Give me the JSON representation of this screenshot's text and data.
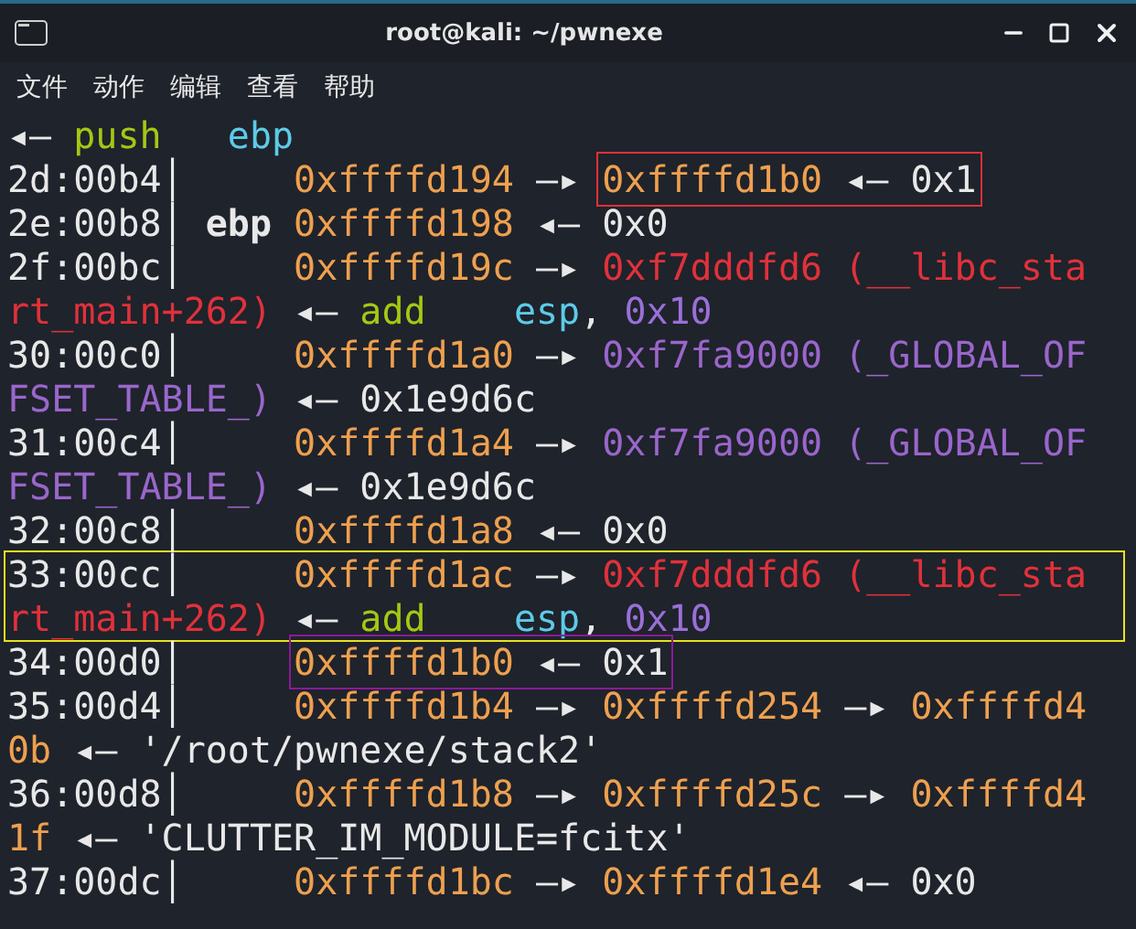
{
  "window": {
    "title": "root@kali: ~/pwnexe"
  },
  "menu": [
    {
      "label": "文件"
    },
    {
      "label": "动作"
    },
    {
      "label": "编辑"
    },
    {
      "label": "查看"
    },
    {
      "label": "帮助"
    }
  ],
  "terminal": {
    "records": [
      {
        "lines": [
          {
            "segments": [
              {
                "kind": "text",
                "text": "◂— ",
                "color": "#e8e8e8"
              },
              {
                "kind": "text",
                "text": "push   ",
                "color": "#a4c814"
              },
              {
                "kind": "text",
                "text": "ebp",
                "color": "#5ccbe8"
              }
            ]
          }
        ]
      },
      {
        "lines": [
          {
            "segments": [
              {
                "kind": "text",
                "text": "2d:00b4│     ",
                "color": "#e8e8e8"
              },
              {
                "kind": "text",
                "text": "0xffffd194",
                "color": "#eea04f"
              },
              {
                "kind": "text",
                "text": " —▸ ",
                "color": "#e8e8e8"
              },
              {
                "kind": "box",
                "color": "#e02f38",
                "segments": [
                  {
                    "kind": "text",
                    "text": "0xffffd1b0",
                    "color": "#eea04f"
                  },
                  {
                    "kind": "text",
                    "text": " ◂— 0x1",
                    "color": "#e8e8e8"
                  }
                ]
              }
            ]
          }
        ]
      },
      {
        "lines": [
          {
            "segments": [
              {
                "kind": "text",
                "text": "2e:00b8│ ",
                "color": "#e8e8e8"
              },
              {
                "kind": "bold",
                "text": "ebp ",
                "color": "#e8e8e8"
              },
              {
                "kind": "text",
                "text": "0xffffd198",
                "color": "#eea04f"
              },
              {
                "kind": "text",
                "text": " ◂— 0x0",
                "color": "#e8e8e8"
              }
            ]
          }
        ]
      },
      {
        "lines": [
          {
            "segments": [
              {
                "kind": "text",
                "text": "2f:00bc│     ",
                "color": "#e8e8e8"
              },
              {
                "kind": "text",
                "text": "0xffffd19c",
                "color": "#eea04f"
              },
              {
                "kind": "text",
                "text": " —▸ ",
                "color": "#e8e8e8"
              },
              {
                "kind": "text",
                "text": "0xf7dddfd6 (__libc_sta",
                "color": "#e0313b"
              }
            ]
          },
          {
            "segments": [
              {
                "kind": "text",
                "text": "rt_main+262)",
                "color": "#e0313b"
              },
              {
                "kind": "text",
                "text": " ◂— ",
                "color": "#e8e8e8"
              },
              {
                "kind": "text",
                "text": "add    ",
                "color": "#a4c814"
              },
              {
                "kind": "text",
                "text": "esp",
                "color": "#5ccbe8"
              },
              {
                "kind": "text",
                "text": ", ",
                "color": "#e8e8e8"
              },
              {
                "kind": "text",
                "text": "0x10",
                "color": "#9a6fd8"
              }
            ]
          }
        ]
      },
      {
        "lines": [
          {
            "segments": [
              {
                "kind": "text",
                "text": "30:00c0│     ",
                "color": "#e8e8e8"
              },
              {
                "kind": "text",
                "text": "0xffffd1a0",
                "color": "#eea04f"
              },
              {
                "kind": "text",
                "text": " —▸ ",
                "color": "#e8e8e8"
              },
              {
                "kind": "text",
                "text": "0xf7fa9000 (_GLOBAL_OF",
                "color": "#9a66cc"
              }
            ]
          },
          {
            "segments": [
              {
                "kind": "text",
                "text": "FSET_TABLE_)",
                "color": "#9a66cc"
              },
              {
                "kind": "text",
                "text": " ◂— 0x1e9d6c",
                "color": "#e8e8e8"
              }
            ]
          }
        ]
      },
      {
        "lines": [
          {
            "segments": [
              {
                "kind": "text",
                "text": "31:00c4│     ",
                "color": "#e8e8e8"
              },
              {
                "kind": "text",
                "text": "0xffffd1a4",
                "color": "#eea04f"
              },
              {
                "kind": "text",
                "text": " —▸ ",
                "color": "#e8e8e8"
              },
              {
                "kind": "text",
                "text": "0xf7fa9000 (_GLOBAL_OF",
                "color": "#9a66cc"
              }
            ]
          },
          {
            "segments": [
              {
                "kind": "text",
                "text": "FSET_TABLE_)",
                "color": "#9a66cc"
              },
              {
                "kind": "text",
                "text": " ◂— 0x1e9d6c",
                "color": "#e8e8e8"
              }
            ]
          }
        ]
      },
      {
        "lines": [
          {
            "segments": [
              {
                "kind": "text",
                "text": "32:00c8│     ",
                "color": "#e8e8e8"
              },
              {
                "kind": "text",
                "text": "0xffffd1a8",
                "color": "#eea04f"
              },
              {
                "kind": "text",
                "text": " ◂— 0x0",
                "color": "#e8e8e8"
              }
            ]
          }
        ]
      },
      {
        "color": "#e8e020",
        "lines": [
          {
            "segments": [
              {
                "kind": "text",
                "text": "33:00cc│     ",
                "color": "#e8e8e8"
              },
              {
                "kind": "text",
                "text": "0xffffd1ac",
                "color": "#eea04f"
              },
              {
                "kind": "text",
                "text": " —▸ ",
                "color": "#e8e8e8"
              },
              {
                "kind": "text",
                "text": "0xf7dddfd6 (__libc_sta",
                "color": "#e0313b"
              }
            ]
          },
          {
            "segments": [
              {
                "kind": "text",
                "text": "rt_main+262)",
                "color": "#e0313b"
              },
              {
                "kind": "text",
                "text": " ◂— ",
                "color": "#e8e8e8"
              },
              {
                "kind": "text",
                "text": "add    ",
                "color": "#a4c814"
              },
              {
                "kind": "text",
                "text": "esp",
                "color": "#5ccbe8"
              },
              {
                "kind": "text",
                "text": ", ",
                "color": "#e8e8e8"
              },
              {
                "kind": "text",
                "text": "0x10",
                "color": "#9a6fd8"
              }
            ]
          }
        ]
      },
      {
        "lines": [
          {
            "segments": [
              {
                "kind": "text",
                "text": "34:00d0│     ",
                "color": "#e8e8e8"
              },
              {
                "kind": "box",
                "color": "#8a1a9a",
                "segments": [
                  {
                    "kind": "text",
                    "text": "0xffffd1b0",
                    "color": "#eea04f"
                  },
                  {
                    "kind": "text",
                    "text": " ◂— 0x1",
                    "color": "#e8e8e8"
                  }
                ]
              }
            ]
          }
        ]
      },
      {
        "lines": [
          {
            "segments": [
              {
                "kind": "text",
                "text": "35:00d4│     ",
                "color": "#e8e8e8"
              },
              {
                "kind": "text",
                "text": "0xffffd1b4",
                "color": "#eea04f"
              },
              {
                "kind": "text",
                "text": " —▸ ",
                "color": "#e8e8e8"
              },
              {
                "kind": "text",
                "text": "0xffffd254",
                "color": "#eea04f"
              },
              {
                "kind": "text",
                "text": " —▸ ",
                "color": "#e8e8e8"
              },
              {
                "kind": "text",
                "text": "0xffffd4",
                "color": "#eea04f"
              }
            ]
          },
          {
            "segments": [
              {
                "kind": "text",
                "text": "0b",
                "color": "#eea04f"
              },
              {
                "kind": "text",
                "text": " ◂— '/root/pwnexe/stack2'",
                "color": "#e8e8e8"
              }
            ]
          }
        ]
      },
      {
        "lines": [
          {
            "segments": [
              {
                "kind": "text",
                "text": "36:00d8│     ",
                "color": "#e8e8e8"
              },
              {
                "kind": "text",
                "text": "0xffffd1b8",
                "color": "#eea04f"
              },
              {
                "kind": "text",
                "text": " —▸ ",
                "color": "#e8e8e8"
              },
              {
                "kind": "text",
                "text": "0xffffd25c",
                "color": "#eea04f"
              },
              {
                "kind": "text",
                "text": " —▸ ",
                "color": "#e8e8e8"
              },
              {
                "kind": "text",
                "text": "0xffffd4",
                "color": "#eea04f"
              }
            ]
          },
          {
            "segments": [
              {
                "kind": "text",
                "text": "1f",
                "color": "#eea04f"
              },
              {
                "kind": "text",
                "text": " ◂— 'CLUTTER_IM_MODULE=fcitx'",
                "color": "#e8e8e8"
              }
            ]
          }
        ]
      },
      {
        "lines": [
          {
            "segments": [
              {
                "kind": "text",
                "text": "37:00dc│     ",
                "color": "#e8e8e8"
              },
              {
                "kind": "text",
                "text": "0xffffd1bc",
                "color": "#eea04f"
              },
              {
                "kind": "text",
                "text": " —▸ ",
                "color": "#e8e8e8"
              },
              {
                "kind": "text",
                "text": "0xffffd1e4",
                "color": "#eea04f"
              },
              {
                "kind": "text",
                "text": " ◂— 0x0",
                "color": "#e8e8e8"
              }
            ]
          }
        ]
      }
    ]
  }
}
